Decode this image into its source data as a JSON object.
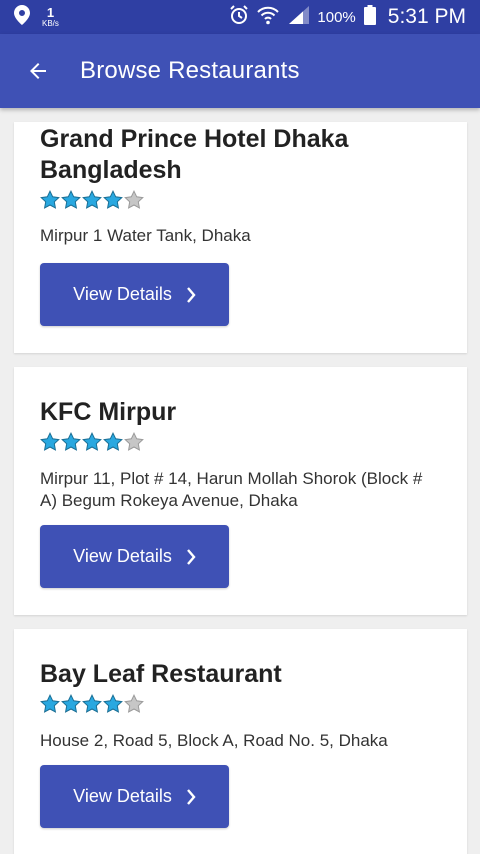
{
  "status_bar": {
    "net_speed": "1",
    "net_unit": "KB/s",
    "battery": "100%",
    "time": "5:31 PM"
  },
  "app_bar": {
    "title": "Browse Restaurants"
  },
  "restaurants": [
    {
      "name": "Grand Prince Hotel Dhaka Bangladesh",
      "rating": 4,
      "address": "Mirpur 1 Water Tank, Dhaka",
      "button_label": "View Details"
    },
    {
      "name": "KFC Mirpur",
      "rating": 4,
      "address": "Mirpur 11, Plot # 14, Harun Mollah Shorok (Block # A) Begum Rokeya Avenue, Dhaka",
      "button_label": "View Details"
    },
    {
      "name": "Bay Leaf Restaurant",
      "rating": 4,
      "address": "House 2, Road 5, Block A, Road No. 5, Dhaka",
      "button_label": "View Details"
    }
  ],
  "rating_max": 5,
  "colors": {
    "primary": "#3f51b5",
    "primary_dark": "#2f3fa3",
    "star_filled": "#29a8e0",
    "star_empty": "#c6c6c6"
  }
}
